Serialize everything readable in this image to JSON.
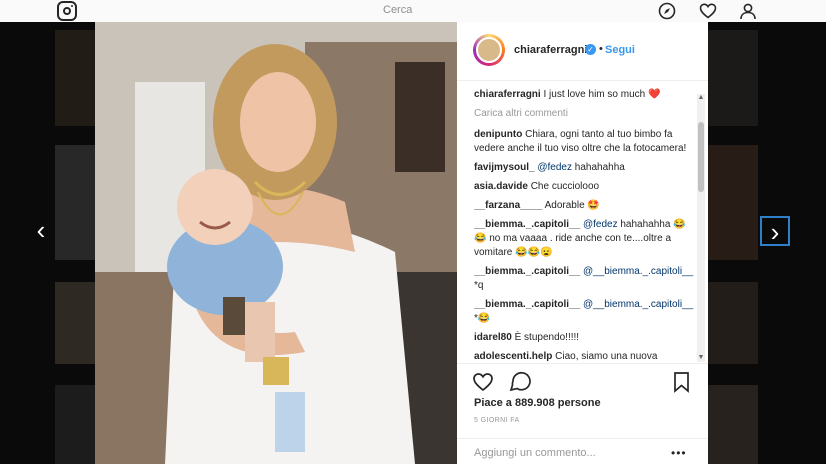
{
  "topbar": {
    "search_placeholder": "Cerca"
  },
  "post": {
    "username": "chiaraferragni",
    "follow_label": "Segui",
    "dot": "•",
    "caption_user": "chiaraferragni",
    "caption_text": " I just love him so much ❤️",
    "load_more": "Carica altri commenti",
    "comments": [
      {
        "user": "denipunto",
        "text": " Chiara, ogni tanto al tuo bimbo fa vedere anche il tuo viso oltre che la fotocamera!"
      },
      {
        "user": "favijmysoul_",
        "mention": " @fedez",
        "text": " hahahahha"
      },
      {
        "user": "asia.davide",
        "text": " Che cucciolooo"
      },
      {
        "user": "__farzana____",
        "text": " Adorable 🤩"
      },
      {
        "user": "__biemma._.capitoli__",
        "mention": " @fedez",
        "text": " hahahahha 😂😂 no ma vaaaa . ride anche con te....oltre a vomitare 😂😂😦"
      },
      {
        "user": "__biemma._.capitoli__",
        "mention": " @__biemma._.capitoli__",
        "text": " *q"
      },
      {
        "user": "__biemma._.capitoli__",
        "mention": " @__biemma._.capitoli__",
        "text": " *😂"
      },
      {
        "user": "idarel80",
        "text": " È stupendo!!!!!"
      },
      {
        "user": "adolescenti.help",
        "text": " Ciao, siamo una nuova"
      }
    ],
    "likes": "Piace a 889.908 persone",
    "time_ago": "5 GIORNI FA",
    "add_comment_placeholder": "Aggiungi un commento...",
    "more_options": "•••"
  },
  "nav": {
    "prev": "‹",
    "next": "›"
  },
  "colors": {
    "accent": "#3897f0",
    "verified": "#3897f0",
    "heart": "#ed4956"
  }
}
